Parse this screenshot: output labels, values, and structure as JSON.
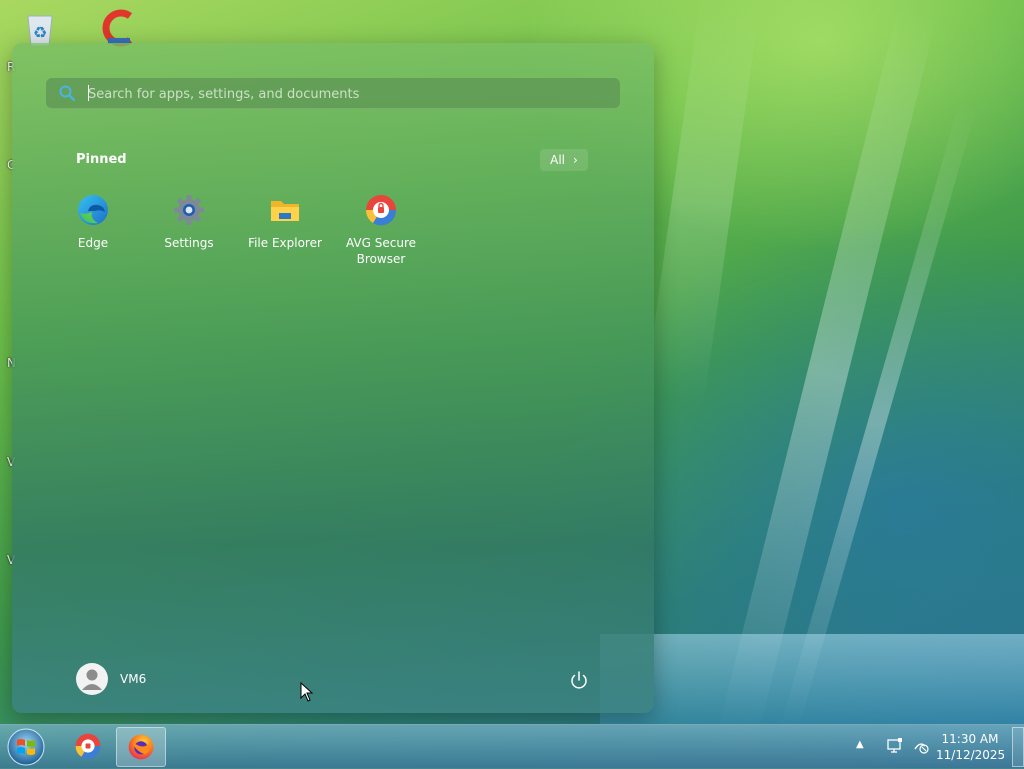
{
  "desktop": {
    "icons": [
      "recycle-bin-icon",
      "ccleaner-icon"
    ],
    "left_edge_letters": [
      "R",
      "C",
      "N",
      "V",
      "V"
    ]
  },
  "start_menu": {
    "search": {
      "placeholder": "Search for apps, settings, and documents",
      "value": ""
    },
    "pinned_title": "Pinned",
    "all_button": {
      "label": "All",
      "icon": "chevron-right-icon"
    },
    "pinned_apps": [
      {
        "label": "Edge",
        "icon": "edge-icon"
      },
      {
        "label": "Settings",
        "icon": "settings-gear-icon"
      },
      {
        "label": "File Explorer",
        "icon": "folder-icon"
      },
      {
        "label": "AVG Secure Browser",
        "icon": "avg-browser-icon"
      }
    ],
    "user": {
      "name": "VM6",
      "icon": "user-avatar-icon"
    },
    "power_icon": "power-icon"
  },
  "taskbar": {
    "start_icon": "windows-start-orb-icon",
    "apps": [
      {
        "name": "avg-secure-browser",
        "icon": "avg-browser-icon",
        "active": false
      },
      {
        "name": "firefox",
        "icon": "firefox-icon",
        "active": true
      }
    ],
    "tray": {
      "icons": [
        "show-hidden-icons-arrow",
        "action-center-icon",
        "network-disconnected-icon"
      ],
      "time": "11:30 AM",
      "date": "11/12/2025"
    }
  },
  "colors": {
    "menu_accent": "#5aa060",
    "taskbar": "#4d95b0",
    "search_icon": "#3aa0d8"
  }
}
